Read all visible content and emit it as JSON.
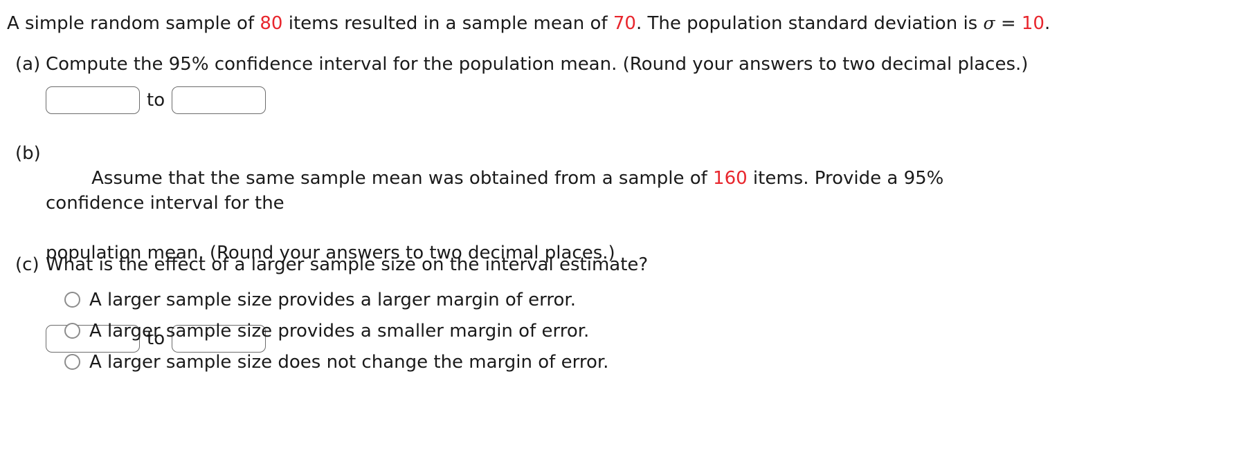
{
  "question": {
    "intro": {
      "seg1": "A simple random sample of ",
      "sample_size": "80",
      "seg2": " items resulted in a sample mean of ",
      "sample_mean": "70",
      "seg3": ". The population standard deviation is ",
      "sigma_symbol": "σ",
      "equals": " = ",
      "sigma_value": "10",
      "seg4": "."
    },
    "parts": [
      {
        "label": "(a)",
        "text": "Compute the 95% confidence interval for the population mean. (Round your answers to two decimal places.)",
        "answer": {
          "lower_value": "",
          "lower_placeholder": "",
          "connector": "to",
          "upper_value": "",
          "upper_placeholder": ""
        }
      },
      {
        "label": "(b)",
        "text_line1_seg1": "Assume that the same sample mean was obtained from a sample of ",
        "text_line1_number": "160",
        "text_line1_seg2": " items. Provide a 95% confidence interval for the",
        "text_line2": "population mean. (Round your answers to two decimal places.)",
        "answer": {
          "lower_value": "",
          "lower_placeholder": "",
          "connector": "to",
          "upper_value": "",
          "upper_placeholder": ""
        }
      },
      {
        "label": "(c)",
        "text": "What is the effect of a larger sample size on the interval estimate?",
        "options": [
          {
            "label": "A larger sample size provides a larger margin of error.",
            "selected": false
          },
          {
            "label": "A larger sample size provides a smaller margin of error.",
            "selected": false
          },
          {
            "label": "A larger sample size does not change the margin of error.",
            "selected": false
          }
        ]
      }
    ]
  },
  "colors": {
    "highlight_red": "#e8262d",
    "text": "#1a1a1a",
    "border_gray": "#6b6b6b",
    "radio_gray": "#8c8c8c"
  }
}
